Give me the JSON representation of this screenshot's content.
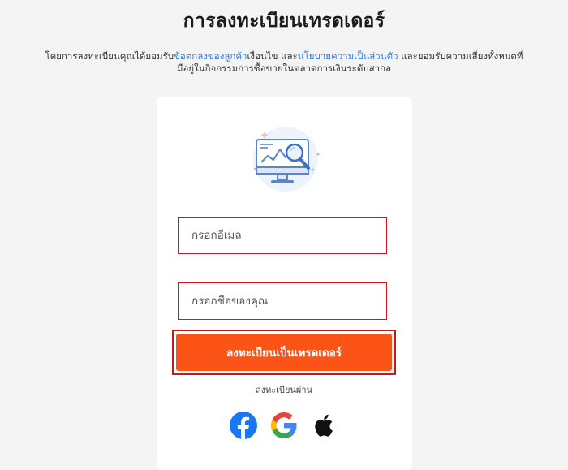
{
  "page": {
    "title": "การลงทะเบียนเทรดเดอร์"
  },
  "consent": {
    "prefix": "โดยการลงทะเบียนคุณได้ยอมรับ",
    "terms_link": "ข้อตกลงของลูกค้า",
    "middle": "เงื่อนไข และ",
    "privacy_link": "นโยบายความเป็นส่วนตัว",
    "suffix": " และยอมรับความเสี่ยงทั้งหมดที่มีอยู่ในกิจกรรมการซื้อขายในตลาดการเงินระดับสากล"
  },
  "form": {
    "email_placeholder": "กรอกอีเมล",
    "name_placeholder": "กรอกชื่อของคุณ",
    "submit_label": "ลงทะเบียนเป็นเทรดเดอร์"
  },
  "social": {
    "divider_label": "ลงทะเบียนผ่าน",
    "providers": [
      "facebook-icon",
      "google-icon",
      "apple-icon"
    ]
  },
  "colors": {
    "accent": "#fc5316",
    "link": "#2f7de1",
    "field_border": "#c8171e",
    "facebook": "#1877f2"
  }
}
